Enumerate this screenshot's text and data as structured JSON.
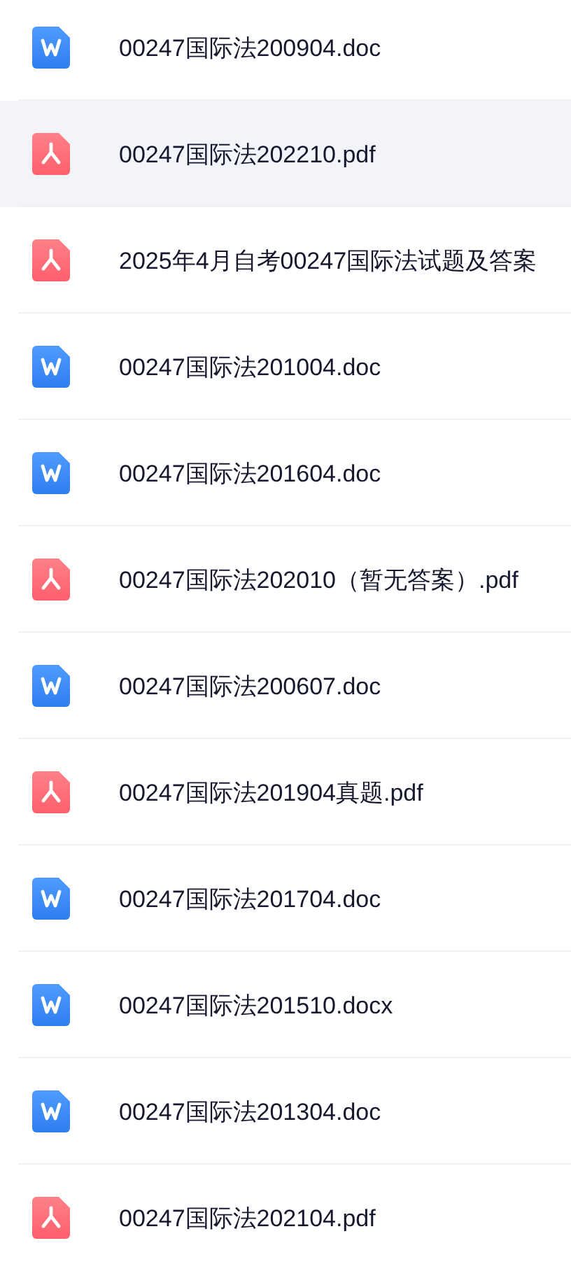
{
  "files": [
    {
      "name": "00247国际法200904.doc",
      "kind": "doc",
      "selected": false
    },
    {
      "name": "00247国际法202210.pdf",
      "kind": "pdf",
      "selected": true
    },
    {
      "name": "2025年4月自考00247国际法试题及答案",
      "kind": "pdf",
      "selected": false
    },
    {
      "name": "00247国际法201004.doc",
      "kind": "doc",
      "selected": false
    },
    {
      "name": "00247国际法201604.doc",
      "kind": "doc",
      "selected": false
    },
    {
      "name": "00247国际法202010（暂无答案）.pdf",
      "kind": "pdf",
      "selected": false
    },
    {
      "name": "00247国际法200607.doc",
      "kind": "doc",
      "selected": false
    },
    {
      "name": "00247国际法201904真题.pdf",
      "kind": "pdf",
      "selected": false
    },
    {
      "name": "00247国际法201704.doc",
      "kind": "doc",
      "selected": false
    },
    {
      "name": "00247国际法201510.docx",
      "kind": "doc",
      "selected": false
    },
    {
      "name": "00247国际法201304.doc",
      "kind": "doc",
      "selected": false
    },
    {
      "name": "00247国际法202104.pdf",
      "kind": "pdf",
      "selected": false
    }
  ]
}
